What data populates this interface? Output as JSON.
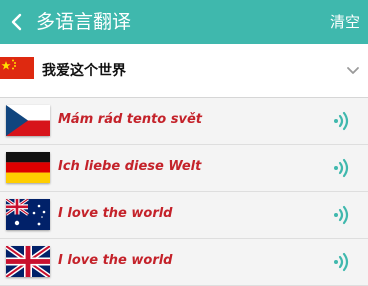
{
  "header": {
    "back_icon": "chevron-left-icon",
    "title": "多语言翻译",
    "clear_label": "清空"
  },
  "source": {
    "flag_icon": "china-flag-icon",
    "text": "我爱这个世界",
    "dropdown_icon": "chevron-down-icon"
  },
  "translations": [
    {
      "language_flag": "czech-flag-icon",
      "text": "Mám rád tento svět",
      "speak_icon": "speaker-wave-icon"
    },
    {
      "language_flag": "germany-flag-icon",
      "text": "Ich liebe diese Welt",
      "speak_icon": "speaker-wave-icon"
    },
    {
      "language_flag": "australia-flag-icon",
      "text": "I love the world",
      "speak_icon": "speaker-wave-icon"
    },
    {
      "language_flag": "uk-flag-icon",
      "text": "I love the world",
      "speak_icon": "speaker-wave-icon"
    }
  ],
  "colors": {
    "header_bg": "#3fb8ad",
    "translation_text": "#c4222a",
    "speaker_icon": "#3fb8ad"
  }
}
